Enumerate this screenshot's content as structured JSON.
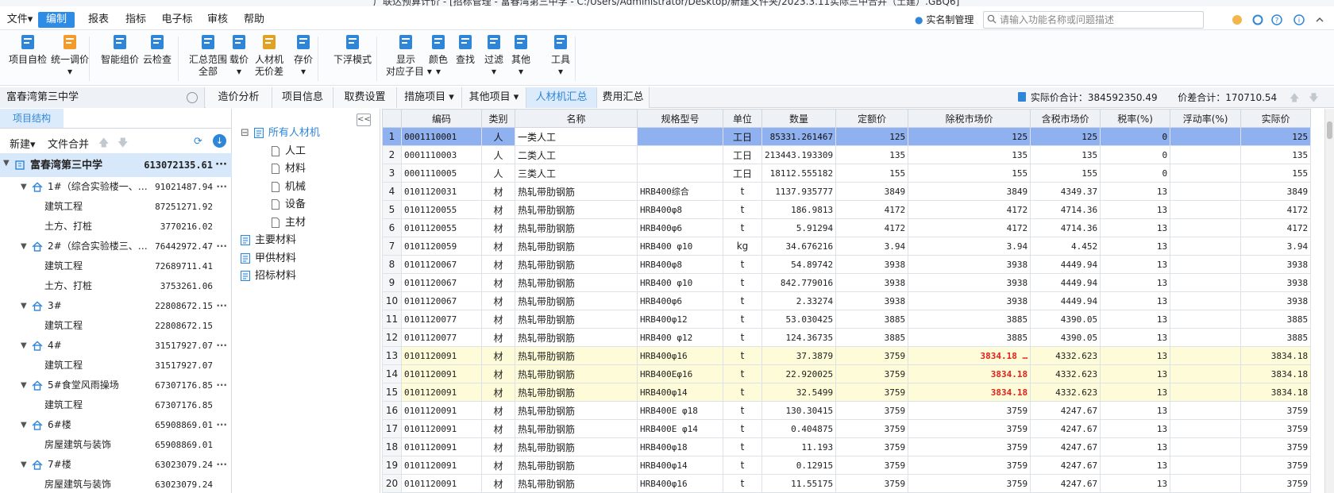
{
  "window": {
    "title": "广联达预算计价 - [招标管理 - 富春湾第三中学 - C:/Users/Administrator/Desktop/新建文件夹/2023.3.11实际三中合并（土建）.GBQ6]"
  },
  "menu": [
    {
      "label": "文件▾",
      "active": false
    },
    {
      "label": "编制",
      "active": true
    },
    {
      "label": "报表",
      "active": false
    },
    {
      "label": "指标",
      "active": false
    },
    {
      "label": "电子标",
      "active": false
    },
    {
      "label": "审核",
      "active": false
    },
    {
      "label": "帮助",
      "active": false
    }
  ],
  "account": {
    "label": "实名制管理"
  },
  "search": {
    "placeholder": "请输入功能名称或问题描述"
  },
  "ribbon": [
    {
      "l1": "项目自检",
      "l2": "",
      "icon": "project-check-icon"
    },
    {
      "l1": "统一调价",
      "l2": "▾",
      "icon": "unified-price-icon"
    },
    {
      "l1": "智能组价",
      "l2": "",
      "icon": "smart-pricing-icon"
    },
    {
      "l1": "云检查",
      "l2": "",
      "icon": "cloud-check-icon"
    },
    {
      "l1": "汇总范围",
      "l2": "全部",
      "icon": "summary-range-icon"
    },
    {
      "l1": "载价",
      "l2": "▾",
      "icon": "load-price-icon"
    },
    {
      "l1": "人材机",
      "l2": "无价差",
      "icon": "labor-material-icon"
    },
    {
      "l1": "存价",
      "l2": "▾",
      "icon": "save-price-icon"
    },
    {
      "l1": "下浮模式",
      "l2": "",
      "icon": "float-mode-icon"
    },
    {
      "l1": "显示",
      "l2": "对应子目 ▾",
      "icon": "show-items-icon"
    },
    {
      "l1": "颜色",
      "l2": "▾",
      "icon": "color-icon"
    },
    {
      "l1": "查找",
      "l2": "",
      "icon": "find-icon"
    },
    {
      "l1": "过滤",
      "l2": "▾",
      "icon": "filter-icon"
    },
    {
      "l1": "其他",
      "l2": "▾",
      "icon": "other-icon"
    },
    {
      "l1": "工具",
      "l2": "▾",
      "icon": "tools-icon"
    }
  ],
  "project": {
    "name": "富春湾第三中学"
  },
  "tabs": [
    {
      "label": "造价分析",
      "active": false
    },
    {
      "label": "项目信息",
      "active": false
    },
    {
      "label": "取费设置",
      "active": false
    },
    {
      "label": "措施项目 ▾",
      "active": false
    },
    {
      "label": "其他项目 ▾",
      "active": false
    },
    {
      "label": "人材机汇总",
      "active": true
    },
    {
      "label": "费用汇总",
      "active": false
    }
  ],
  "totals": {
    "actual": "实际价合计：384592350.49",
    "diff": "价差合计：170710.54"
  },
  "left": {
    "tab": "项目结构",
    "new_label": "新建▾",
    "merge_label": "文件合并",
    "tree": [
      {
        "name": "富春湾第三中学",
        "value": "613072135.61",
        "level": 0,
        "kind": "root",
        "arrow": "▼"
      },
      {
        "name": "1#（综合实验楼一、…",
        "value": "91021487.94",
        "level": 1,
        "kind": "house",
        "arrow": "▼"
      },
      {
        "name": "建筑工程",
        "value": "87251271.92",
        "level": 2,
        "kind": "leaf",
        "arrow": ""
      },
      {
        "name": "土方、打桩",
        "value": "3770216.02",
        "level": 2,
        "kind": "leaf",
        "arrow": ""
      },
      {
        "name": "2#（综合实验楼三、…",
        "value": "76442972.47",
        "level": 1,
        "kind": "house",
        "arrow": "▼"
      },
      {
        "name": "建筑工程",
        "value": "72689711.41",
        "level": 2,
        "kind": "leaf",
        "arrow": ""
      },
      {
        "name": "土方、打桩",
        "value": "3753261.06",
        "level": 2,
        "kind": "leaf",
        "arrow": ""
      },
      {
        "name": "3#",
        "value": "22808672.15",
        "level": 1,
        "kind": "house",
        "arrow": "▼"
      },
      {
        "name": "建筑工程",
        "value": "22808672.15",
        "level": 2,
        "kind": "leaf",
        "arrow": ""
      },
      {
        "name": "4#",
        "value": "31517927.07",
        "level": 1,
        "kind": "house",
        "arrow": "▼"
      },
      {
        "name": "建筑工程",
        "value": "31517927.07",
        "level": 2,
        "kind": "leaf",
        "arrow": ""
      },
      {
        "name": "5#食堂风雨操场",
        "value": "67307176.85",
        "level": 1,
        "kind": "house",
        "arrow": "▼"
      },
      {
        "name": "建筑工程",
        "value": "67307176.85",
        "level": 2,
        "kind": "leaf",
        "arrow": ""
      },
      {
        "name": "6#楼",
        "value": "65908869.01",
        "level": 1,
        "kind": "house",
        "arrow": "▼"
      },
      {
        "name": "房屋建筑与装饰",
        "value": "65908869.01",
        "level": 2,
        "kind": "leaf",
        "arrow": ""
      },
      {
        "name": "7#楼",
        "value": "63023079.24",
        "level": 1,
        "kind": "house",
        "arrow": "▼"
      },
      {
        "name": "房屋建筑与装饰",
        "value": "63023079.24",
        "level": 2,
        "kind": "leaf",
        "arrow": ""
      }
    ]
  },
  "middle": {
    "collapse": "<<",
    "nodes": [
      {
        "label": "所有人材机",
        "kind": "all",
        "indent": 0,
        "expander": "⊟"
      },
      {
        "label": "人工",
        "kind": "doc",
        "indent": 1,
        "expander": ""
      },
      {
        "label": "材料",
        "kind": "doc",
        "indent": 1,
        "expander": ""
      },
      {
        "label": "机械",
        "kind": "doc",
        "indent": 1,
        "expander": ""
      },
      {
        "label": "设备",
        "kind": "doc",
        "indent": 1,
        "expander": ""
      },
      {
        "label": "主材",
        "kind": "doc",
        "indent": 1,
        "expander": ""
      },
      {
        "label": "主要材料",
        "kind": "edit",
        "indent": 0,
        "expander": ""
      },
      {
        "label": "甲供材料",
        "kind": "edit",
        "indent": 0,
        "expander": ""
      },
      {
        "label": "招标材料",
        "kind": "edit",
        "indent": 0,
        "expander": ""
      }
    ]
  },
  "grid": {
    "columns": [
      "",
      "编码",
      "类别",
      "名称",
      "规格型号",
      "单位",
      "数量",
      "定额价",
      "除税市场价",
      "含税市场价",
      "税率(%)",
      "浮动率(%)",
      "实际价"
    ],
    "rows": [
      {
        "n": "1",
        "code": "0001110001",
        "cat": "人",
        "name": "一类人工",
        "spec": "",
        "unit": "工日",
        "qty": "85331.261467",
        "quota": "125",
        "extax": "125",
        "intax": "125",
        "rate": "0",
        "float": "",
        "actual": "125",
        "style": "sel",
        "red": false
      },
      {
        "n": "2",
        "code": "0001110003",
        "cat": "人",
        "name": "二类人工",
        "spec": "",
        "unit": "工日",
        "qty": "213443.193309",
        "quota": "135",
        "extax": "135",
        "intax": "135",
        "rate": "0",
        "float": "",
        "actual": "135",
        "style": "",
        "red": false
      },
      {
        "n": "3",
        "code": "0001110005",
        "cat": "人",
        "name": "三类人工",
        "spec": "",
        "unit": "工日",
        "qty": "18112.555182",
        "quota": "155",
        "extax": "155",
        "intax": "155",
        "rate": "0",
        "float": "",
        "actual": "155",
        "style": "",
        "red": false
      },
      {
        "n": "4",
        "code": "0101120031",
        "cat": "材",
        "name": "热轧带肋钢筋",
        "spec": "HRB400综合",
        "unit": "t",
        "qty": "1137.935777",
        "quota": "3849",
        "extax": "3849",
        "intax": "4349.37",
        "rate": "13",
        "float": "",
        "actual": "3849",
        "style": "",
        "red": false
      },
      {
        "n": "5",
        "code": "0101120055",
        "cat": "材",
        "name": "热轧带肋钢筋",
        "spec": "HRB400φ8",
        "unit": "t",
        "qty": "186.9813",
        "quota": "4172",
        "extax": "4172",
        "intax": "4714.36",
        "rate": "13",
        "float": "",
        "actual": "4172",
        "style": "",
        "red": false
      },
      {
        "n": "6",
        "code": "0101120055",
        "cat": "材",
        "name": "热轧带肋钢筋",
        "spec": "HRB400φ6",
        "unit": "t",
        "qty": "5.91294",
        "quota": "4172",
        "extax": "4172",
        "intax": "4714.36",
        "rate": "13",
        "float": "",
        "actual": "4172",
        "style": "",
        "red": false
      },
      {
        "n": "7",
        "code": "0101120059",
        "cat": "材",
        "name": "热轧带肋钢筋",
        "spec": "HRB400 φ10",
        "unit": "kg",
        "qty": "34.676216",
        "quota": "3.94",
        "extax": "3.94",
        "intax": "4.452",
        "rate": "13",
        "float": "",
        "actual": "3.94",
        "style": "",
        "red": false
      },
      {
        "n": "8",
        "code": "0101120067",
        "cat": "材",
        "name": "热轧带肋钢筋",
        "spec": "HRB400φ8",
        "unit": "t",
        "qty": "54.89742",
        "quota": "3938",
        "extax": "3938",
        "intax": "4449.94",
        "rate": "13",
        "float": "",
        "actual": "3938",
        "style": "",
        "red": false
      },
      {
        "n": "9",
        "code": "0101120067",
        "cat": "材",
        "name": "热轧带肋钢筋",
        "spec": "HRB400 φ10",
        "unit": "t",
        "qty": "842.779016",
        "quota": "3938",
        "extax": "3938",
        "intax": "4449.94",
        "rate": "13",
        "float": "",
        "actual": "3938",
        "style": "",
        "red": false
      },
      {
        "n": "10",
        "code": "0101120067",
        "cat": "材",
        "name": "热轧带肋钢筋",
        "spec": "HRB400φ6",
        "unit": "t",
        "qty": "2.33274",
        "quota": "3938",
        "extax": "3938",
        "intax": "4449.94",
        "rate": "13",
        "float": "",
        "actual": "3938",
        "style": "",
        "red": false
      },
      {
        "n": "11",
        "code": "0101120077",
        "cat": "材",
        "name": "热轧带肋钢筋",
        "spec": "HRB400φ12",
        "unit": "t",
        "qty": "53.030425",
        "quota": "3885",
        "extax": "3885",
        "intax": "4390.05",
        "rate": "13",
        "float": "",
        "actual": "3885",
        "style": "",
        "red": false
      },
      {
        "n": "12",
        "code": "0101120077",
        "cat": "材",
        "name": "热轧带肋钢筋",
        "spec": "HRB400 φ12",
        "unit": "t",
        "qty": "124.36735",
        "quota": "3885",
        "extax": "3885",
        "intax": "4390.05",
        "rate": "13",
        "float": "",
        "actual": "3885",
        "style": "",
        "red": false
      },
      {
        "n": "13",
        "code": "0101120091",
        "cat": "材",
        "name": "热轧带肋钢筋",
        "spec": "HRB400φ16",
        "unit": "t",
        "qty": "37.3879",
        "quota": "3759",
        "extax": "3834.18 …",
        "intax": "4332.623",
        "rate": "13",
        "float": "",
        "actual": "3834.18",
        "style": "yel",
        "red": true
      },
      {
        "n": "14",
        "code": "0101120091",
        "cat": "材",
        "name": "热轧带肋钢筋",
        "spec": "HRB400Eφ16",
        "unit": "t",
        "qty": "22.920025",
        "quota": "3759",
        "extax": "3834.18",
        "intax": "4332.623",
        "rate": "13",
        "float": "",
        "actual": "3834.18",
        "style": "yel",
        "red": true
      },
      {
        "n": "15",
        "code": "0101120091",
        "cat": "材",
        "name": "热轧带肋钢筋",
        "spec": "HRB400φ14",
        "unit": "t",
        "qty": "32.5499",
        "quota": "3759",
        "extax": "3834.18",
        "intax": "4332.623",
        "rate": "13",
        "float": "",
        "actual": "3834.18",
        "style": "yel",
        "red": true
      },
      {
        "n": "16",
        "code": "0101120091",
        "cat": "材",
        "name": "热轧带肋钢筋",
        "spec": "HRB400E φ18",
        "unit": "t",
        "qty": "130.30415",
        "quota": "3759",
        "extax": "3759",
        "intax": "4247.67",
        "rate": "13",
        "float": "",
        "actual": "3759",
        "style": "",
        "red": false
      },
      {
        "n": "17",
        "code": "0101120091",
        "cat": "材",
        "name": "热轧带肋钢筋",
        "spec": "HRB400E φ14",
        "unit": "t",
        "qty": "0.404875",
        "quota": "3759",
        "extax": "3759",
        "intax": "4247.67",
        "rate": "13",
        "float": "",
        "actual": "3759",
        "style": "",
        "red": false
      },
      {
        "n": "18",
        "code": "0101120091",
        "cat": "材",
        "name": "热轧带肋钢筋",
        "spec": "HRB400φ18",
        "unit": "t",
        "qty": "11.193",
        "quota": "3759",
        "extax": "3759",
        "intax": "4247.67",
        "rate": "13",
        "float": "",
        "actual": "3759",
        "style": "",
        "red": false
      },
      {
        "n": "19",
        "code": "0101120091",
        "cat": "材",
        "name": "热轧带肋钢筋",
        "spec": "HRB400φ14",
        "unit": "t",
        "qty": "0.12915",
        "quota": "3759",
        "extax": "3759",
        "intax": "4247.67",
        "rate": "13",
        "float": "",
        "actual": "3759",
        "style": "",
        "red": false
      },
      {
        "n": "20",
        "code": "0101120091",
        "cat": "材",
        "name": "热轧带肋钢筋",
        "spec": "HRB400φ16",
        "unit": "t",
        "qty": "11.55175",
        "quota": "3759",
        "extax": "3759",
        "intax": "4247.67",
        "rate": "13",
        "float": "",
        "actual": "3759",
        "style": "",
        "red": false
      }
    ]
  },
  "colors": {
    "accent": "#2f8ce6",
    "selected_row": "#8fb1ef",
    "highlight_row": "#fdfbd8",
    "changed_price": "#e0201a",
    "active_tab": "#dcebfb"
  }
}
